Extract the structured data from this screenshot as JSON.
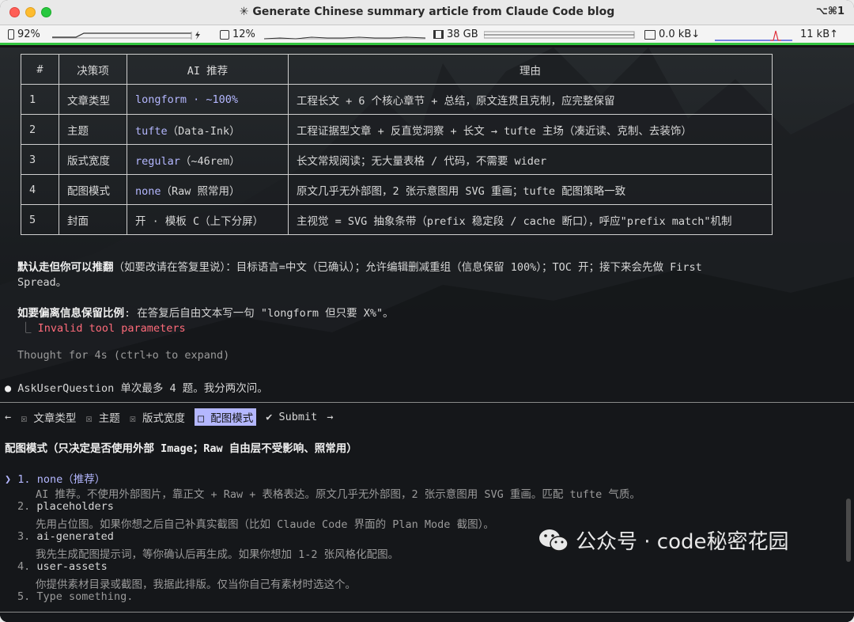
{
  "window": {
    "title": "✳ Generate Chinese summary article from Claude Code blog",
    "shortcut": "⌥⌘1"
  },
  "status": {
    "battery": "92%",
    "cpu": "12%",
    "memory": "38 GB",
    "net_down": "0.0 kB↓",
    "net_up": "11 kB↑"
  },
  "table": {
    "headers": [
      "#",
      "决策项",
      "AI 推荐",
      "理由"
    ],
    "rows": [
      {
        "num": "1",
        "item": "文章类型",
        "ai_main": "longform · ~100%",
        "ai_extra": "",
        "reason": "工程长文 + 6 个核心章节 + 总结，原文连贯且克制，应完整保留"
      },
      {
        "num": "2",
        "item": "主题",
        "ai_main": "tufte",
        "ai_extra": "（Data-Ink）",
        "reason": "工程证据型文章 + 反直觉洞察 + 长文 → tufte 主场（凑近读、克制、去装饰）"
      },
      {
        "num": "3",
        "item": "版式宽度",
        "ai_main": "regular",
        "ai_extra": "（~46rem）",
        "reason": "长文常规阅读；无大量表格 / 代码，不需要 wider"
      },
      {
        "num": "4",
        "item": "配图模式",
        "ai_main": "none",
        "ai_extra": "（Raw 照常用）",
        "reason": "原文几乎无外部图，2 张示意图用 SVG 重画；tufte 配图策略一致"
      },
      {
        "num": "5",
        "item": "封面",
        "ai_main": "",
        "ai_extra": "开 · 模板 C（上下分屏）",
        "reason": "主视觉 = SVG 抽象条带（prefix 稳定段 / cache 断口），呼应\"prefix match\"机制"
      }
    ]
  },
  "text": {
    "default_bold": "默认走但你可以推翻",
    "default_rest": "（如要改请在答复里说）：目标语言=中文（已确认）；允许编辑删减重组（信息保留 100%）；TOC 开；接下来会先做 First",
    "default_line2": "Spread。",
    "ratio_bold": "如要偏离信息保留比例",
    "ratio_rest": ": 在答复后自由文本写一句 \"longform 但只要 X%\"。",
    "error_prefix": "⎿",
    "error": "Invalid tool parameters",
    "thought": "Thought for 4s (ctrl+o to expand)",
    "bullet": "●",
    "ask_line": "AskUserQuestion 单次最多 4 题。我分两次问。"
  },
  "tabs": {
    "left_arrow": "←",
    "items": [
      {
        "mark": "☒",
        "label": "文章类型"
      },
      {
        "mark": "☒",
        "label": "主题"
      },
      {
        "mark": "☒",
        "label": "版式宽度"
      },
      {
        "mark": "□",
        "label": "配图模式"
      },
      {
        "mark": "✔",
        "label": "Submit"
      }
    ],
    "right_arrow": "→"
  },
  "question": {
    "title": "配图模式（只决定是否使用外部 Image；Raw 自由层不受影响、照常用）",
    "pointer": "❯",
    "options": [
      {
        "num": "1.",
        "label": "none（推荐）",
        "desc": "AI 推荐。不使用外部图片，靠正文 + Raw + 表格表达。原文几乎无外部图，2 张示意图用 SVG 重画。匹配 tufte 气质。"
      },
      {
        "num": "2.",
        "label": "placeholders",
        "desc": "先用占位图。如果你想之后自己补真实截图（比如 Claude Code 界面的 Plan Mode 截图）。"
      },
      {
        "num": "3.",
        "label": "ai-generated",
        "desc": "我先生成配图提示词，等你确认后再生成。如果你想加 1-2 张风格化配图。"
      },
      {
        "num": "4.",
        "label": "user-assets",
        "desc": "你提供素材目录或截图，我据此排版。仅当你自己有素材时选这个。"
      },
      {
        "num": "5.",
        "label": "Type something.",
        "desc": ""
      }
    ]
  },
  "watermark": "公众号 · code秘密花园"
}
